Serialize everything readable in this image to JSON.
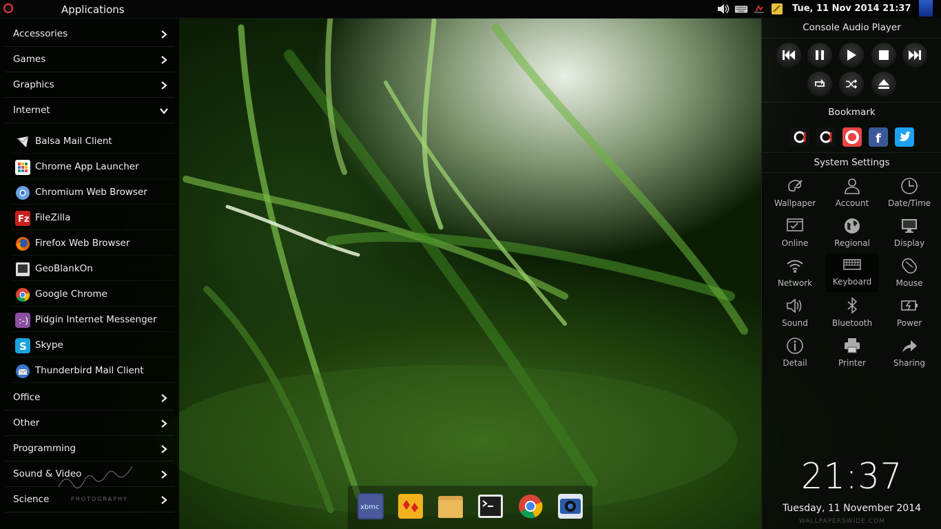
{
  "top_panel": {
    "title": "Applications",
    "datetime": "Tue, 11 Nov 2014 21:37",
    "tray_icons": [
      "volume-icon",
      "keyboard-icon",
      "network-icon",
      "note-icon"
    ]
  },
  "menu": {
    "categories_top": [
      {
        "label": "Accessories",
        "expanded": false
      },
      {
        "label": "Games",
        "expanded": false
      },
      {
        "label": "Graphics",
        "expanded": false
      },
      {
        "label": "Internet",
        "expanded": true
      }
    ],
    "internet_apps": [
      {
        "label": "Balsa Mail Client",
        "icon": "balsa-icon"
      },
      {
        "label": "Chrome App Launcher",
        "icon": "app-launcher-icon"
      },
      {
        "label": "Chromium Web Browser",
        "icon": "chromium-icon"
      },
      {
        "label": "FileZilla",
        "icon": "filezilla-icon"
      },
      {
        "label": "Firefox Web Browser",
        "icon": "firefox-icon"
      },
      {
        "label": "GeoBlankOn",
        "icon": "geoblankon-icon"
      },
      {
        "label": "Google Chrome",
        "icon": "chrome-icon"
      },
      {
        "label": "Pidgin Internet Messenger",
        "icon": "pidgin-icon"
      },
      {
        "label": "Skype",
        "icon": "skype-icon"
      },
      {
        "label": "Thunderbird Mail Client",
        "icon": "thunderbird-icon"
      }
    ],
    "categories_bottom": [
      {
        "label": "Office"
      },
      {
        "label": "Other"
      },
      {
        "label": "Programming"
      },
      {
        "label": "Sound & Video"
      },
      {
        "label": "Science"
      }
    ]
  },
  "audio_player": {
    "title": "Console Audio Player",
    "controls": [
      "previous-icon",
      "pause-icon",
      "play-icon",
      "stop-icon",
      "next-icon",
      "repeat-icon",
      "shuffle-icon",
      "eject-icon"
    ]
  },
  "bookmark": {
    "title": "Bookmark",
    "items": [
      "blankon-icon",
      "blankon-icon",
      "help-icon",
      "facebook-icon",
      "twitter-icon"
    ]
  },
  "system_settings": {
    "title": "System Settings",
    "items": [
      {
        "label": "Wallpaper",
        "icon": "wallpaper-icon"
      },
      {
        "label": "Account",
        "icon": "account-icon"
      },
      {
        "label": "Date/Time",
        "icon": "clock-icon"
      },
      {
        "label": "Online",
        "icon": "online-icon"
      },
      {
        "label": "Regional",
        "icon": "globe-icon"
      },
      {
        "label": "Display",
        "icon": "monitor-icon"
      },
      {
        "label": "Network",
        "icon": "wifi-icon"
      },
      {
        "label": "Keyboard",
        "icon": "keyboard-icon"
      },
      {
        "label": "Mouse",
        "icon": "mouse-icon"
      },
      {
        "label": "Sound",
        "icon": "speaker-icon"
      },
      {
        "label": "Bluetooth",
        "icon": "bluetooth-icon"
      },
      {
        "label": "Power",
        "icon": "battery-icon"
      },
      {
        "label": "Detail",
        "icon": "info-icon"
      },
      {
        "label": "Printer",
        "icon": "printer-icon"
      },
      {
        "label": "Sharing",
        "icon": "share-icon"
      }
    ],
    "active": "Keyboard"
  },
  "clock": {
    "time": "21:37",
    "date": "Tuesday, 11 November 2014"
  },
  "dock": {
    "items": [
      "xbmc-icon",
      "game-icon",
      "files-icon",
      "terminal-icon",
      "chrome-icon",
      "camera-icon"
    ]
  },
  "signature": {
    "text": "Sentot T. PHOTOGRAPHY"
  },
  "colors": {
    "panel": "#050505",
    "menu_bg": "rgba(0,0,0,0.82)",
    "grass": "#2f6a17",
    "facebook": "#3b5998",
    "twitter": "#1da1f2"
  }
}
